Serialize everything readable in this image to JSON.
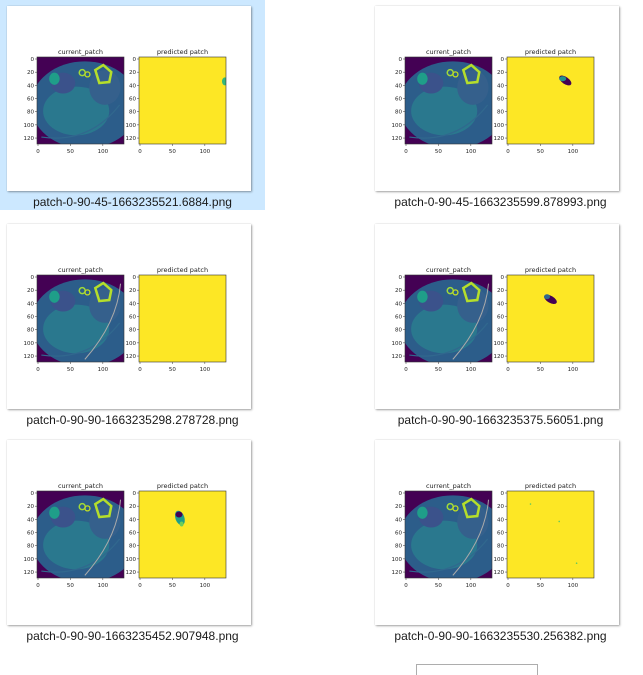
{
  "plot": {
    "left_title": "current_patch",
    "right_title": "predicted patch",
    "y_ticks": [
      "0",
      "20",
      "40",
      "60",
      "80",
      "100",
      "120"
    ],
    "x_ticks": [
      "0",
      "50",
      "100"
    ]
  },
  "files": [
    {
      "name": "patch-0-90-45-1663235521.6884.png",
      "selected": true
    },
    {
      "name": "patch-0-90-45-1663235599.878993.png",
      "selected": false
    },
    {
      "name": "patch-0-90-90-1663235298.278728.png",
      "selected": false
    },
    {
      "name": "patch-0-90-90-1663235375.56051.png",
      "selected": false
    },
    {
      "name": "patch-0-90-90-1663235452.907948.png",
      "selected": false
    },
    {
      "name": "patch-0-90-90-1663235530.256382.png",
      "selected": false
    }
  ],
  "colors": {
    "selection": "#cce8ff",
    "prediction_background": "#fde725",
    "ct_background": "#440154",
    "ct_tissue": "#2a788e",
    "ct_bright": "#b5de2b"
  }
}
